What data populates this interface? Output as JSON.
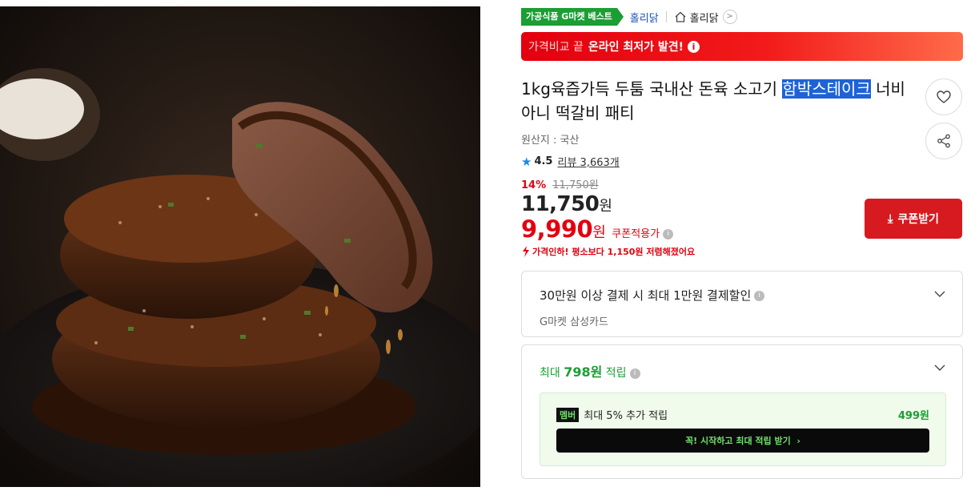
{
  "header": {
    "best_badge": "가공식품 G마켓 베스트",
    "brand": "홀리닭",
    "shop": "홀리닭"
  },
  "promo_banner": {
    "light": "가격비교 끝",
    "strong": "온라인 최저가 발견!"
  },
  "product": {
    "title_before": "1kg육즙가득 두툼 국내산 돈육 소고기 ",
    "title_highlight": "함박스테이크",
    "title_after": " 너비아니 떡갈비 패티",
    "origin": "원산지 : 국산",
    "rating": "4.5",
    "review_label": "리뷰",
    "review_count": "3,663개",
    "discount_rate": "14%",
    "list_price": "11,750원",
    "price": "11,750",
    "price_unit": "원",
    "sale_price": "9,990",
    "sale_unit": "원",
    "coupon_note": "쿠폰적용가",
    "drop_note": "가격인하! 평소보다 1,150원 저렴해졌어요"
  },
  "actions": {
    "coupon_button": "쿠폰받기"
  },
  "card_payment": {
    "title": "30만원 이상 결제 시 최대 1만원 결제할인",
    "subtitle": "G마켓 삼성카드"
  },
  "card_points": {
    "prefix": "최대 ",
    "amount": "798원",
    "suffix": " 적립",
    "member_tag": "멤버",
    "member_text": "최대 5% 추가 적립",
    "member_points": "499원",
    "member_cta": "꼭! 시작하고 최대 적립 받기"
  },
  "colors": {
    "accent_red": "#e3000f",
    "accent_green": "#1b9e33",
    "link_blue": "#1a4fb5"
  }
}
